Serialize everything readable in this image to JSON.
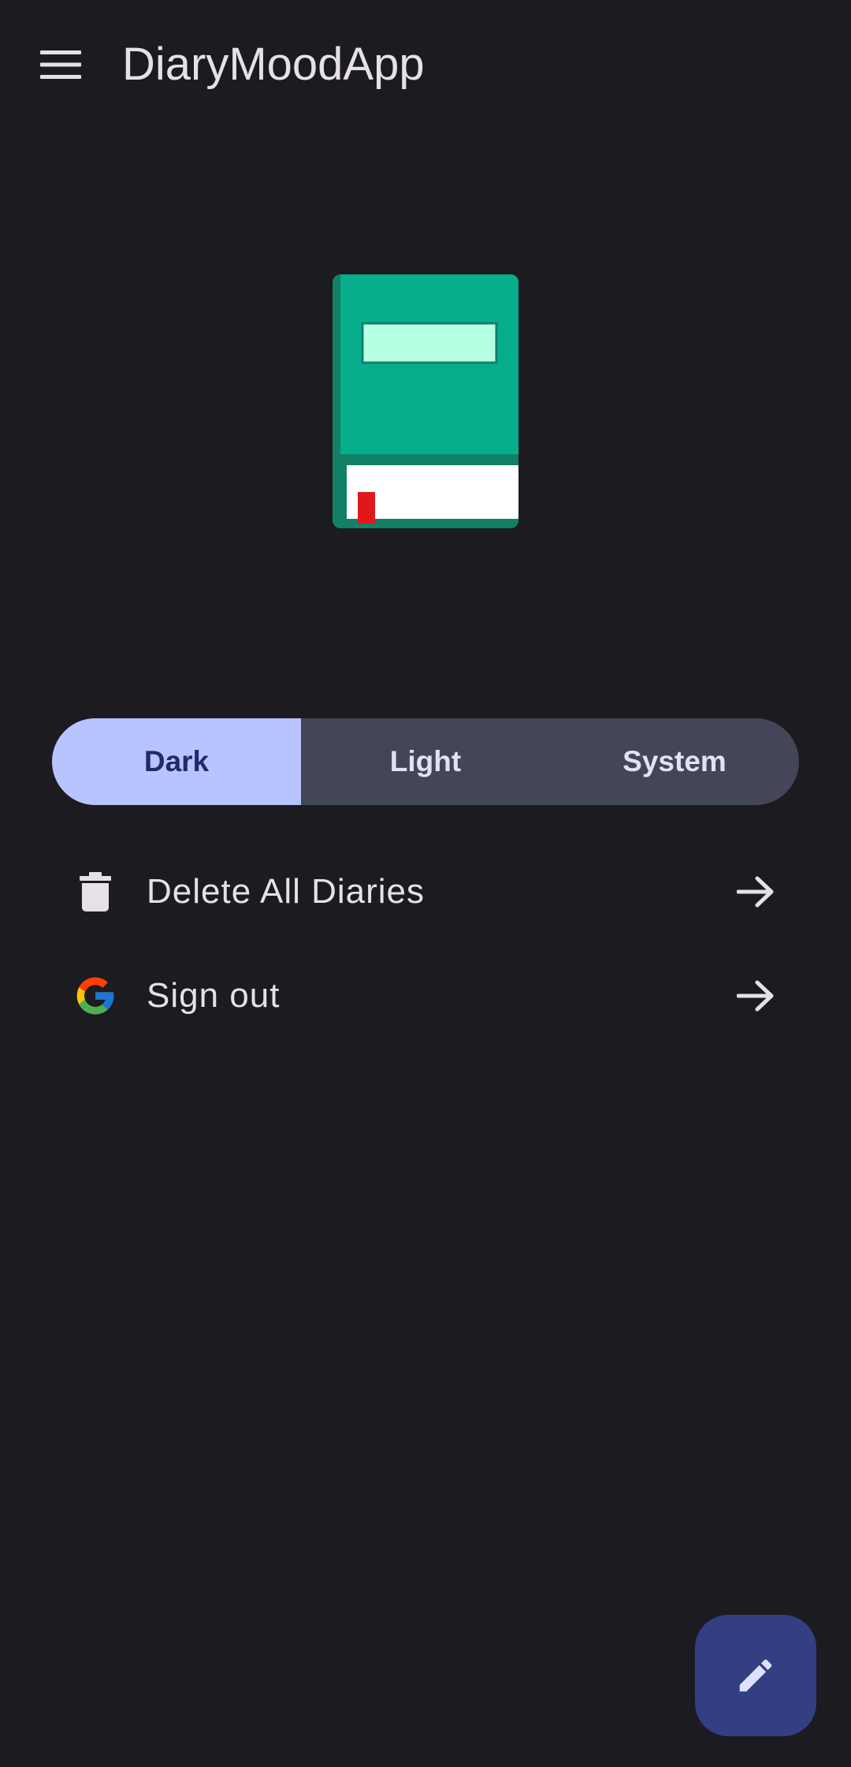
{
  "app_bar": {
    "title": "DiaryMoodApp",
    "menu_icon": "hamburger-menu-icon"
  },
  "illustration": {
    "icon": "diary-book-icon",
    "colors": {
      "cover": "#07ae8c",
      "spine": "#128066",
      "label": "#b5ffe3",
      "pages": "#ffffff",
      "bookmark": "#e0181b"
    }
  },
  "theme_selector": {
    "options": [
      {
        "label": "Dark",
        "selected": true
      },
      {
        "label": "Light",
        "selected": false
      },
      {
        "label": "System",
        "selected": false
      }
    ],
    "selected_color": "#b8c4ff",
    "unselected_color": "#434659"
  },
  "settings": [
    {
      "label": "Delete All Diaries",
      "icon": "trash-icon",
      "arrow_icon": "arrow-right-icon"
    },
    {
      "label": "Sign out",
      "icon": "google-icon",
      "arrow_icon": "arrow-right-icon"
    }
  ],
  "fab": {
    "icon": "pencil-icon",
    "color": "#323f82"
  },
  "colors": {
    "background": "#1c1b20",
    "text": "#e6e1e6"
  }
}
